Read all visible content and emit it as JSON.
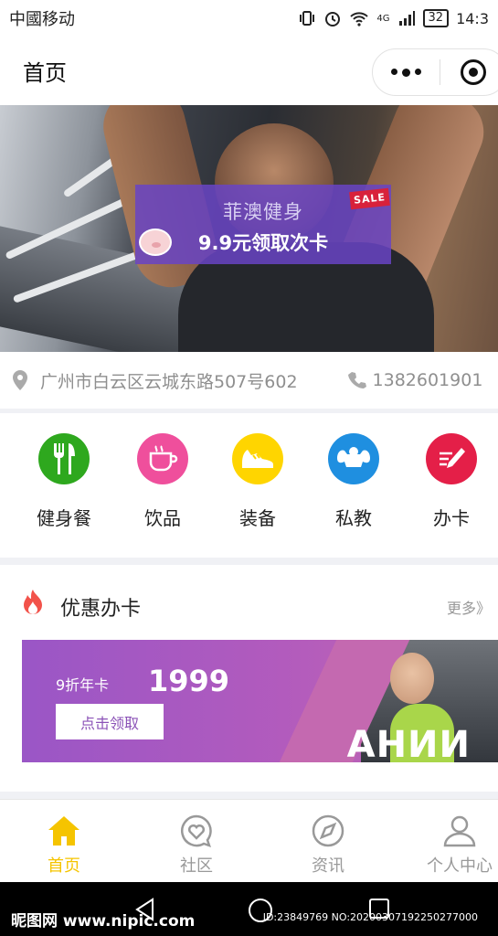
{
  "status_bar": {
    "carrier": "中國移动",
    "network": "4G",
    "battery": "32",
    "time": "14:3"
  },
  "header": {
    "title": "首页"
  },
  "banner": {
    "promo_title": "菲澳健身",
    "promo_offer": "9.9元领取次卡",
    "sale_tag": "SALE"
  },
  "info": {
    "address": "广州市白云区云城东路507号602",
    "phone": "1382601901"
  },
  "categories": [
    {
      "label": "健身餐",
      "icon": "fork-knife-icon",
      "color": "#2ea81e"
    },
    {
      "label": "饮品",
      "icon": "cup-icon",
      "color": "#ef4f9c"
    },
    {
      "label": "装备",
      "icon": "shoe-icon",
      "color": "#ffd500"
    },
    {
      "label": "私教",
      "icon": "muscle-icon",
      "color": "#1f8fe0"
    },
    {
      "label": "办卡",
      "icon": "card-pen-icon",
      "color": "#e41f48"
    }
  ],
  "offers": {
    "title": "优惠办卡",
    "more": "更多》",
    "card": {
      "name": "9折年卡",
      "price": "1999",
      "button": "点击领取",
      "watermark": "АНИИ"
    }
  },
  "tabs": [
    {
      "label": "首页",
      "icon": "home-icon",
      "active": true
    },
    {
      "label": "社区",
      "icon": "heart-chat-icon",
      "active": false
    },
    {
      "label": "资讯",
      "icon": "compass-icon",
      "active": false
    },
    {
      "label": "个人中心",
      "icon": "user-icon",
      "active": false
    }
  ],
  "watermarks": {
    "site": "昵图网 www.nipic.com",
    "id": "ID:23849769 NO:20200307192250277000"
  },
  "colors": {
    "accent": "#f5c400",
    "promo": "#6844c4",
    "card": "#9a56c6"
  }
}
